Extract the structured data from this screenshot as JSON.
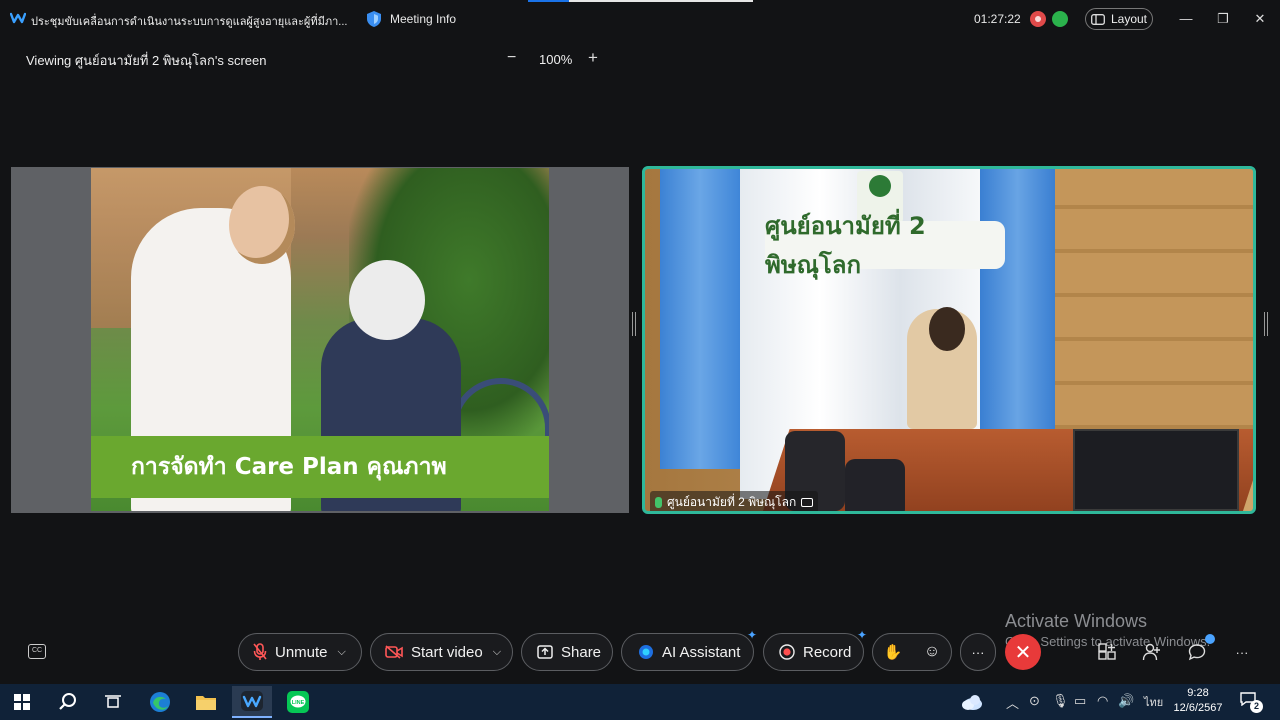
{
  "window": {
    "title": "ประชุมขับเคลื่อนการดำเนินงานระบบการดูแลผู้สูงอายุและผู้ที่มีภา...",
    "meeting_info_label": "Meeting Info",
    "timer": "01:27:22",
    "layout_label": "Layout",
    "minimize_icon": "minimize-icon",
    "restore_icon": "restore-icon",
    "close_icon": "close-icon",
    "loading_progress": 0.18
  },
  "viewing_bar": {
    "label": "Viewing ศูนย์อนามัยที่ 2 พิษณุโลก's screen",
    "zoom_minus": "−",
    "zoom_level": "100%",
    "zoom_plus": "+"
  },
  "shared_slide": {
    "caption": "การจัดทำ Care Plan คุณภาพ"
  },
  "video": {
    "sign_text": "ศูนย์อนามัยที่ 2 พิษณุโลก",
    "participant_name": "ศูนย์อนามัยที่ 2 พิษณุโลก",
    "highlight_color": "#2fb89a"
  },
  "watermark": {
    "title": "Activate Windows",
    "subtitle": "Go to Settings to activate Windows."
  },
  "controls": {
    "unmute": "Unmute",
    "start_video": "Start video",
    "share": "Share",
    "ai_assistant": "AI Assistant",
    "record": "Record",
    "more": "···",
    "overflow": "···",
    "end_color": "#e83a3a"
  },
  "taskbar": {
    "time": "9:28",
    "date": "12/6/2567",
    "language": "ไทย",
    "notification_count": "2"
  }
}
